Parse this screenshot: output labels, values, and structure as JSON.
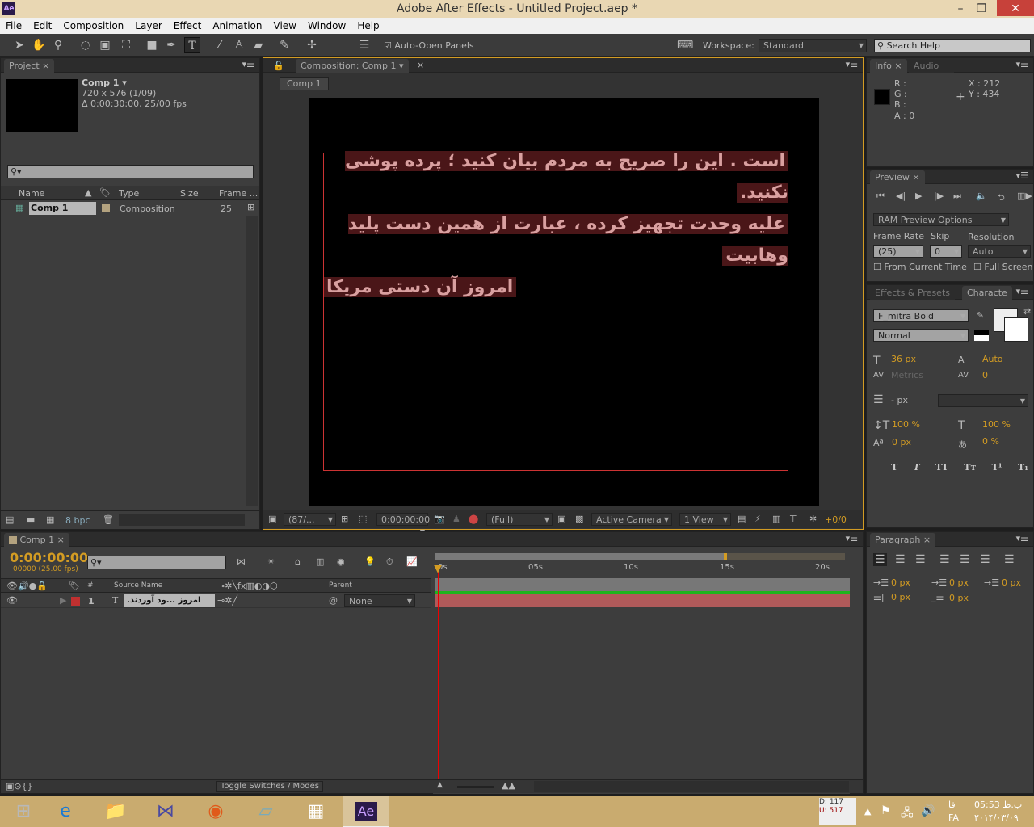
{
  "window": {
    "title": "Adobe After Effects - Untitled Project.aep *",
    "app_icon": "Ae"
  },
  "menu": [
    "File",
    "Edit",
    "Composition",
    "Layer",
    "Effect",
    "Animation",
    "View",
    "Window",
    "Help"
  ],
  "toolbar": {
    "auto_open_panels": "Auto-Open Panels",
    "auto_open_checked": true,
    "workspace_label": "Workspace:",
    "workspace_value": "Standard",
    "search_placeholder": "Search Help"
  },
  "project": {
    "tab": "Project",
    "comp_name": "Comp 1 ▾",
    "comp_size": "720 x 576 (1/09)",
    "comp_duration": "Δ 0:00:30:00, 25/00 fps",
    "columns": [
      "Name",
      "Type",
      "Size",
      "Frame ..."
    ],
    "items": [
      {
        "name": "Comp 1",
        "type": "Composition",
        "size": "",
        "frame_rate": "25",
        "label_color": "#b3a27f"
      }
    ],
    "bpc": "8 bpc"
  },
  "composition": {
    "tab": "Composition: Comp 1",
    "breadcrumb": "Comp 1",
    "text_lines": [
      "است . این را صریح به مردم بیان کنید ؛ پرده پوشی نکنید.",
      "علیه وحدت تجهیز کرده ، عبارت از همین دست پلید وهابیت",
      "امروز آن دستی مریکا"
    ],
    "zoom": "(87/...",
    "timecode": "0:00:00:00",
    "resolution": "(Full)",
    "camera": "Active Camera",
    "views": "1 View",
    "exposure": "+0/0"
  },
  "info": {
    "tabs": [
      "Info",
      "Audio"
    ],
    "r": "R :",
    "g": "G :",
    "b": "B :",
    "a": "A : 0",
    "x": "X : 212",
    "y": "Y : 434"
  },
  "preview": {
    "tab": "Preview",
    "ram_options": "RAM Preview Options",
    "frame_rate_label": "Frame Rate",
    "skip_label": "Skip",
    "resolution_label": "Resolution",
    "frame_rate": "(25)",
    "skip": "0",
    "resolution": "Auto",
    "from_current_time": "From Current Time",
    "full_screen": "Full Screen"
  },
  "character": {
    "tabs": [
      "Effects & Presets",
      "Characte"
    ],
    "font": "F_mitra Bold",
    "style": "Normal",
    "size": "36 px",
    "leading": "Auto",
    "kerning": "Metrics",
    "tracking": "0",
    "stroke": "- px",
    "vscale": "100 %",
    "hscale": "100 %",
    "baseline": "0 px",
    "tsume": "0 %",
    "styles": [
      "T",
      "T",
      "TT",
      "Tт",
      "T¹",
      "T₁"
    ]
  },
  "paragraph": {
    "tab": "Paragraph",
    "indent_left": "0 px",
    "indent_first": "0 px",
    "indent_right": "0 px",
    "space_before": "0 px",
    "space_after": "0 px"
  },
  "timeline": {
    "tab": "Comp 1",
    "timecode": "0:00:00:00",
    "frames": "00000 (25.00 fps)",
    "columns": {
      "num": "#",
      "source": "Source Name",
      "parent": "Parent"
    },
    "layers": [
      {
        "num": "1",
        "name": ".امروز ...ود آوردند",
        "parent": "None",
        "label_color": "#c03030"
      }
    ],
    "ruler": [
      "0s",
      "05s",
      "10s",
      "15s",
      "20s"
    ],
    "toggle": "Toggle Switches / Modes"
  },
  "taskbar": {
    "net_down": "D: 117",
    "net_up": "U: 517",
    "lang": "فا",
    "lang_code": "FA",
    "time": "05:53 ب.ظ",
    "date": "۲۰۱۴/۰۳/۰۹"
  }
}
